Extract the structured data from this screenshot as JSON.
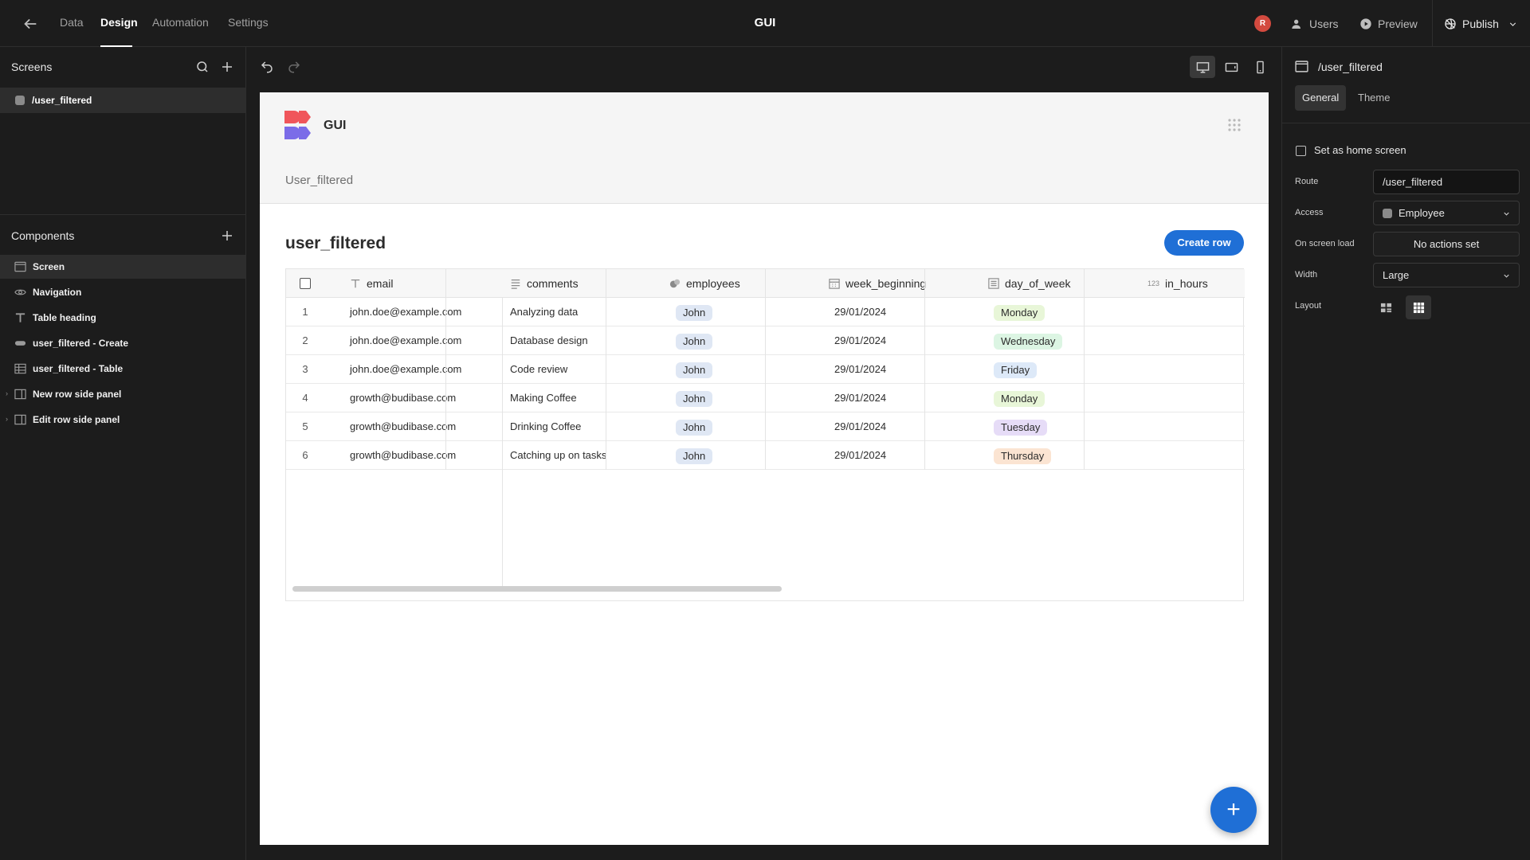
{
  "topbar": {
    "tabs": [
      "Data",
      "Design",
      "Automation",
      "Settings"
    ],
    "active_tab": "Design",
    "app_title": "GUI",
    "avatar_initial": "R",
    "users_label": "Users",
    "preview_label": "Preview",
    "publish_label": "Publish"
  },
  "screens_panel": {
    "title": "Screens",
    "items": [
      "/user_filtered"
    ]
  },
  "components_panel": {
    "title": "Components",
    "items": [
      {
        "label": "Screen",
        "icon": "screen-icon"
      },
      {
        "label": "Navigation",
        "icon": "eye-icon"
      },
      {
        "label": "Table heading",
        "icon": "text-icon"
      },
      {
        "label": "user_filtered - Create",
        "icon": "form-icon"
      },
      {
        "label": "user_filtered - Table",
        "icon": "table-icon"
      },
      {
        "label": "New row side panel",
        "icon": "side-panel-icon"
      },
      {
        "label": "Edit row side panel",
        "icon": "side-panel-icon"
      }
    ]
  },
  "canvas": {
    "brand": "GUI",
    "nav_link": "User_filtered",
    "heading": "user_filtered",
    "create_button": "Create row",
    "fab_label": "+",
    "table": {
      "columns": [
        "email",
        "comments",
        "employees",
        "week_beginning",
        "day_of_week",
        "in_hours"
      ],
      "column_icons": [
        "text-icon",
        "paragraph-icon",
        "relationship-icon",
        "calendar-icon",
        "options-icon",
        "number-icon"
      ],
      "number_icon_text": "123",
      "rows": [
        {
          "idx": "1",
          "email": "john.doe@example.com",
          "comments": "Analyzing data",
          "employee": "John",
          "week": "29/01/2024",
          "day": "Monday"
        },
        {
          "idx": "2",
          "email": "john.doe@example.com",
          "comments": "Database design",
          "employee": "John",
          "week": "29/01/2024",
          "day": "Wednesday"
        },
        {
          "idx": "3",
          "email": "john.doe@example.com",
          "comments": "Code review",
          "employee": "John",
          "week": "29/01/2024",
          "day": "Friday"
        },
        {
          "idx": "4",
          "email": "growth@budibase.com",
          "comments": "Making Coffee",
          "employee": "John",
          "week": "29/01/2024",
          "day": "Monday"
        },
        {
          "idx": "5",
          "email": "growth@budibase.com",
          "comments": "Drinking Coffee",
          "employee": "John",
          "week": "29/01/2024",
          "day": "Tuesday"
        },
        {
          "idx": "6",
          "email": "growth@budibase.com",
          "comments": "Catching up on tasks",
          "employee": "John",
          "week": "29/01/2024",
          "day": "Thursday"
        }
      ],
      "day_colors": {
        "Monday": "#e8f6d8",
        "Wednesday": "#dcf5e3",
        "Friday": "#dde9f8",
        "Tuesday": "#e6dcf7",
        "Thursday": "#fbe4d2"
      },
      "employee_pill_color": "#dfe7f4"
    }
  },
  "right_panel": {
    "title": "/user_filtered",
    "tabs": [
      "General",
      "Theme"
    ],
    "home_screen_label": "Set as home screen",
    "route_label": "Route",
    "route_value": "/user_filtered",
    "access_label": "Access",
    "access_value": "Employee",
    "on_load_label": "On screen load",
    "on_load_value": "No actions set",
    "width_label": "Width",
    "width_value": "Large",
    "layout_label": "Layout"
  },
  "colors": {
    "accent": "#1f6fd6",
    "avatar": "#d34a3f",
    "logo_red": "#f0565b",
    "logo_purple": "#7b6ce8"
  }
}
